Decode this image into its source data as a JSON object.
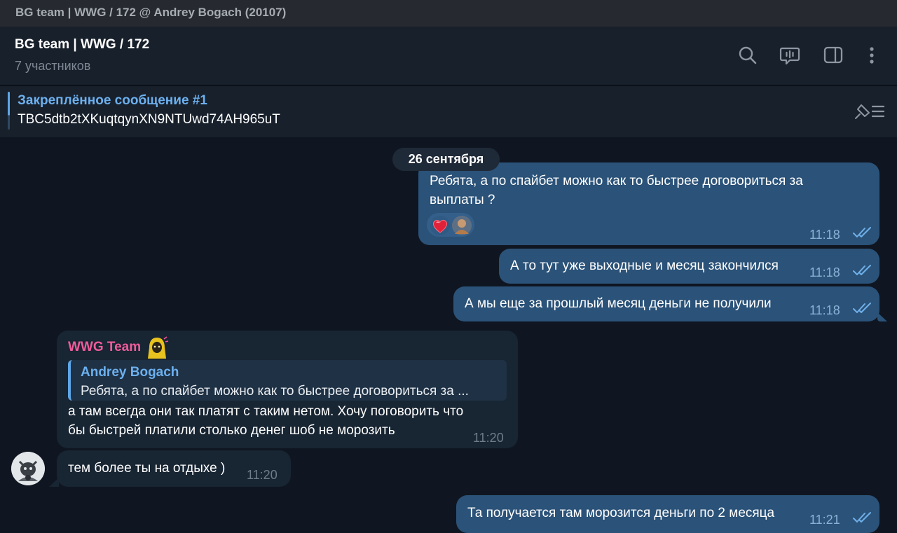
{
  "window": {
    "title": "BG team | WWG / 172 @ Andrey Bogach (20107)"
  },
  "header": {
    "title": "BG team | WWG / 172",
    "subtitle": "7 участников",
    "icons": [
      "search-icon",
      "voice-chat-icon",
      "sidebar-toggle-icon",
      "more-icon"
    ]
  },
  "pinned": {
    "title": "Закреплённое сообщение #1",
    "text": "TBC5dtb2tXKuqtqynXN9NTUwd74AH965uT"
  },
  "date_separator": "26 сентября",
  "messages": [
    {
      "direction": "out",
      "lines": [
        "Ребята, а по спайбет можно как то быстрее договориться за",
        "выплаты ?"
      ],
      "time": "11:18",
      "read": true,
      "reactions": [
        "heart-emoji",
        "user-avatar-reaction"
      ]
    },
    {
      "direction": "out",
      "lines": [
        "А то тут уже выходные и месяц закончился"
      ],
      "time": "11:18",
      "read": true
    },
    {
      "direction": "out",
      "lines": [
        "А мы еще за прошлый месяц деньги не получили"
      ],
      "time": "11:18",
      "read": true
    },
    {
      "direction": "in",
      "sender": "WWG Team",
      "reply": {
        "name": "Andrey Bogach",
        "text": "Ребята, а по спайбет можно как то быстрее договориться за ..."
      },
      "lines": [
        "а там всегда они так платят с таким нетом. Хочу поговорить что",
        "бы быстрей платили столько денег шоб не морозить"
      ],
      "time": "11:20"
    },
    {
      "direction": "in",
      "lines": [
        "тем более ты на отдыхе )"
      ],
      "time": "11:20"
    },
    {
      "direction": "out",
      "lines": [
        "Та получается там морозится деньги по 2 месяца"
      ],
      "time": "11:21",
      "read": true
    }
  ],
  "colors": {
    "background": "#0f1621",
    "header": "#18202b",
    "outgoing_bubble": "#2b5278",
    "incoming_bubble": "#182533",
    "accent": "#6cb0ef",
    "sender_name": "#ef5c9b"
  }
}
